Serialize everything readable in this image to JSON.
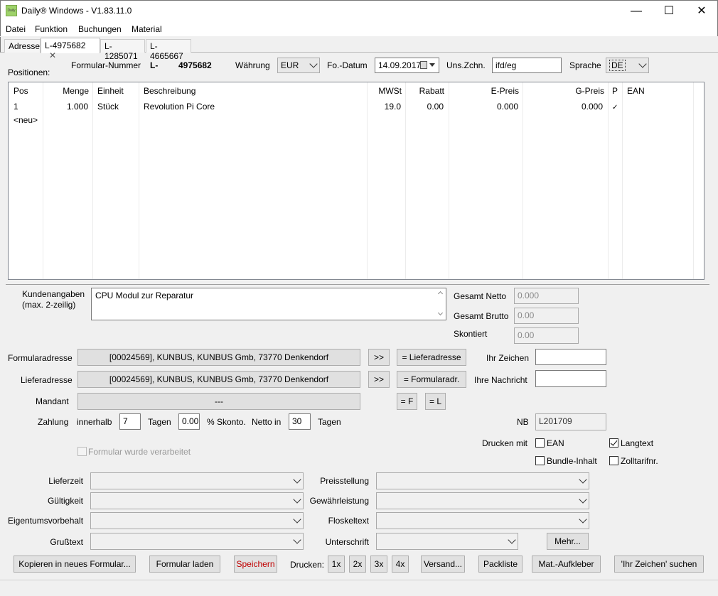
{
  "window": {
    "title": "Daily® Windows - V1.83.11.0",
    "logo_text": "Daily",
    "minimize": "—",
    "maximize": "☐",
    "close": "✕"
  },
  "menu": [
    "Datei",
    "Funktion",
    "Buchungen",
    "Material"
  ],
  "tabs": [
    {
      "label": "Adresse",
      "active": false
    },
    {
      "label": "L-4975682",
      "active": true,
      "close": "✕"
    },
    {
      "label": "L-1285071",
      "active": false
    },
    {
      "label": "L-4665667",
      "active": false
    }
  ],
  "header": {
    "positionen_label": "Positionen:",
    "formular_label": "Formular-Nummer",
    "formular_prefix": "L-",
    "formular_number": "4975682",
    "waehrung_label": "Währung",
    "waehrung_value": "EUR",
    "datum_label": "Fo.-Datum",
    "datum_value": "14.09.2017",
    "unszchn_label": "Uns.Zchn.",
    "unszchn_value": "ifd/eg",
    "sprache_label": "Sprache",
    "sprache_value": "DE"
  },
  "table": {
    "columns": [
      "Pos",
      "Menge",
      "Einheit",
      "Beschreibung",
      "MWSt",
      "Rabatt",
      "E-Preis",
      "G-Preis",
      "P",
      "EAN"
    ],
    "rows": [
      {
        "pos": "1",
        "menge": "1.000",
        "einheit": "Stück",
        "beschreibung": "Revolution Pi Core",
        "mwst": "19.0",
        "rabatt": "0.00",
        "epreis": "0.000",
        "gpreis": "0.000",
        "p": "✓",
        "ean": ""
      }
    ],
    "new_row": "<neu>"
  },
  "kunden": {
    "label_line1": "Kundenangaben",
    "label_line2": "(max. 2-zeilig)",
    "value": "CPU Modul zur Reparatur"
  },
  "totals": {
    "netto_label": "Gesamt Netto",
    "netto_value": "0.000",
    "brutto_label": "Gesamt Brutto",
    "brutto_value": "0.00",
    "skontiert_label": "Skontiert",
    "skontiert_value": "0.00"
  },
  "address": {
    "formular_label": "Formularadresse",
    "formular_value": "[00024569], KUNBUS, KUNBUS Gmb, 73770 Denkendorf",
    "liefer_label": "Lieferadresse",
    "liefer_value": "[00024569], KUNBUS, KUNBUS Gmb, 73770 Denkendorf",
    "mandant_label": "Mandant",
    "mandant_value": "---",
    "arrow_btn": ">>",
    "to_liefer_btn": "= Lieferadresse",
    "to_formular_btn": "= Formularadr.",
    "eq_f_btn": "= F",
    "eq_l_btn": "= L",
    "ihr_zeichen_label": "Ihr Zeichen",
    "ihr_zeichen_value": "",
    "ihre_nachricht_label": "Ihre Nachricht",
    "ihre_nachricht_value": ""
  },
  "payment": {
    "zahlung_label": "Zahlung",
    "innerhalb_label": "innerhalb",
    "tage_value": "7",
    "tagen_label": "Tagen",
    "skonto_value": "0.00",
    "skonto_label": "% Skonto.",
    "netto_in_label": "Netto in",
    "netto_tage_value": "30",
    "tagen2_label": "Tagen",
    "nb_label": "NB",
    "nb_value": "L201709"
  },
  "print_options": {
    "verarbeitet_label": "Formular wurde verarbeitet",
    "drucken_mit_label": "Drucken mit",
    "ean_label": "EAN",
    "langtext_label": "Langtext",
    "bundle_label": "Bundle-Inhalt",
    "zolltarif_label": "Zolltarifnr."
  },
  "dropdowns": {
    "lieferzeit": "Lieferzeit",
    "gueltigkeit": "Gültigkeit",
    "eigentum": "Eigentumsvorbehalt",
    "gruss": "Grußtext",
    "preisstellung": "Preisstellung",
    "gewaehr": "Gewährleistung",
    "floskel": "Floskeltext",
    "unterschrift": "Unterschrift",
    "mehr_btn": "Mehr..."
  },
  "bottom": {
    "kopieren": "Kopieren in neues Formular...",
    "laden": "Formular laden",
    "speichern": "Speichern",
    "drucken_label": "Drucken:",
    "d1": "1x",
    "d2": "2x",
    "d3": "3x",
    "d4": "4x",
    "versand": "Versand...",
    "packliste": "Packliste",
    "aufkleber": "Mat.-Aufkleber",
    "suchen": "'Ihr Zeichen' suchen"
  },
  "colors": {
    "speichern_text": "#c00000"
  }
}
